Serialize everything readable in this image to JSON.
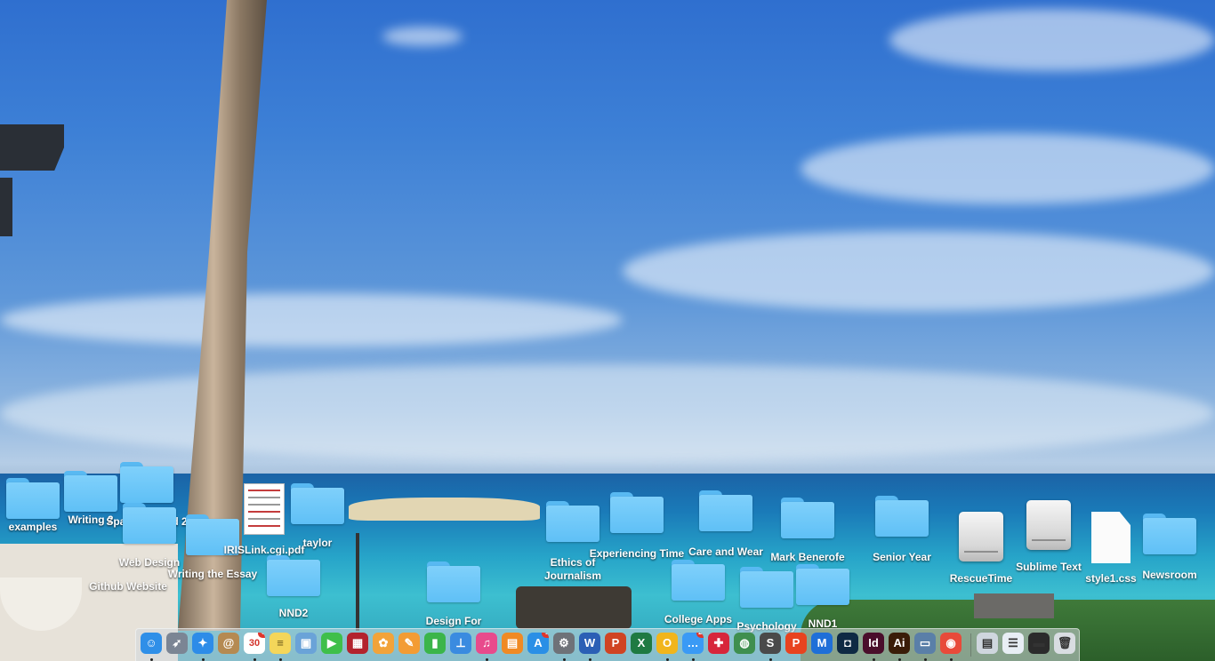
{
  "desktop_icons": [
    {
      "label": "examples",
      "kind": "folder"
    },
    {
      "label": "Writing 2",
      "kind": "folder"
    },
    {
      "label": "Spanish 1 and 2",
      "kind": "folder"
    },
    {
      "label": "Web Design",
      "kind": "folder"
    },
    {
      "label": "Github Website",
      "kind": "folder"
    },
    {
      "label": "Writing the Essay",
      "kind": "folder"
    },
    {
      "label": "IRISLink.cgi.pdf",
      "kind": "pdf"
    },
    {
      "label": "taylor",
      "kind": "folder"
    },
    {
      "label": "NND2",
      "kind": "folder"
    },
    {
      "label": "Design For",
      "kind": "folder"
    },
    {
      "label": "Ethics of Journalism",
      "kind": "folder"
    },
    {
      "label": "Experiencing Time",
      "kind": "folder"
    },
    {
      "label": "Care and Wear",
      "kind": "folder"
    },
    {
      "label": "College Apps",
      "kind": "folder"
    },
    {
      "label": "Psychology",
      "kind": "folder"
    },
    {
      "label": "Mark Benerofe",
      "kind": "folder"
    },
    {
      "label": "NND1",
      "kind": "folder"
    },
    {
      "label": "Senior Year",
      "kind": "folder"
    },
    {
      "label": "RescueTime",
      "kind": "drive"
    },
    {
      "label": "Sublime Text",
      "kind": "drive"
    },
    {
      "label": "style1.css",
      "kind": "document"
    },
    {
      "label": "Newsroom",
      "kind": "folder"
    }
  ],
  "dock": {
    "apps": [
      {
        "name": "Finder",
        "icon": "finder-icon",
        "glyph": "☺",
        "color": "#2f8fe8",
        "running": true
      },
      {
        "name": "Launchpad",
        "icon": "rocket-icon",
        "glyph": "➶",
        "color": "#7b8594",
        "running": false
      },
      {
        "name": "Safari",
        "icon": "compass-icon",
        "glyph": "✦",
        "color": "#2d8ce8",
        "running": true
      },
      {
        "name": "Contacts",
        "icon": "address-book-icon",
        "glyph": "@",
        "color": "#b58a52",
        "running": false
      },
      {
        "name": "Calendar",
        "icon": "calendar-icon",
        "glyph": "30",
        "color": "#ffffff",
        "badge": "6",
        "running": true
      },
      {
        "name": "Notes",
        "icon": "notes-icon",
        "glyph": "≡",
        "color": "#f4d65a",
        "running": true
      },
      {
        "name": "Preview",
        "icon": "preview-icon",
        "glyph": "▣",
        "color": "#6aa3d8",
        "running": false
      },
      {
        "name": "FaceTime",
        "icon": "video-camera-icon",
        "glyph": "▶",
        "color": "#3fbf4a",
        "running": false
      },
      {
        "name": "Photo Booth",
        "icon": "photo-booth-icon",
        "glyph": "▦",
        "color": "#b3232e",
        "running": false
      },
      {
        "name": "Photos",
        "icon": "photos-icon",
        "glyph": "✿",
        "color": "#f2a33a",
        "running": false
      },
      {
        "name": "Pages",
        "icon": "pages-icon",
        "glyph": "✎",
        "color": "#f39c34",
        "running": false
      },
      {
        "name": "Numbers",
        "icon": "numbers-icon",
        "glyph": "▮",
        "color": "#3bb54a",
        "running": false
      },
      {
        "name": "Keynote",
        "icon": "keynote-icon",
        "glyph": "⊥",
        "color": "#3a8be0",
        "running": false
      },
      {
        "name": "iTunes",
        "icon": "music-icon",
        "glyph": "♫",
        "color": "#e84a8c",
        "running": true
      },
      {
        "name": "iBooks",
        "icon": "book-icon",
        "glyph": "▤",
        "color": "#f08a24",
        "running": false
      },
      {
        "name": "App Store",
        "icon": "app-store-icon",
        "glyph": "A",
        "color": "#2a8fe6",
        "badge": "1",
        "running": false
      },
      {
        "name": "System Preferences",
        "icon": "gear-icon",
        "glyph": "⚙",
        "color": "#6e7278",
        "running": true
      },
      {
        "name": "Word",
        "icon": "word-icon",
        "glyph": "W",
        "color": "#2b5fb5",
        "running": true
      },
      {
        "name": "PowerPoint",
        "icon": "powerpoint-icon",
        "glyph": "P",
        "color": "#d04423",
        "running": false
      },
      {
        "name": "Excel",
        "icon": "excel-icon",
        "glyph": "X",
        "color": "#1f7a42",
        "running": false
      },
      {
        "name": "Outlook",
        "icon": "outlook-icon",
        "glyph": "O",
        "color": "#f1b51c",
        "running": true
      },
      {
        "name": "Messages",
        "icon": "chat-bubble-icon",
        "glyph": "…",
        "color": "#3a9af5",
        "badge": "25",
        "running": true
      },
      {
        "name": "Self Service",
        "icon": "plus-icon",
        "glyph": "✚",
        "color": "#d7263b",
        "running": false
      },
      {
        "name": "Network Utility",
        "icon": "globe-icon",
        "glyph": "◍",
        "color": "#3f8f4f",
        "running": false
      },
      {
        "name": "Sublime Text",
        "icon": "sublime-text-icon",
        "glyph": "S",
        "color": "#4a4a4a",
        "running": true
      },
      {
        "name": "Acrobat",
        "icon": "acrobat-icon",
        "glyph": "P",
        "color": "#e8431f",
        "running": false
      },
      {
        "name": "Malwarebytes",
        "icon": "malwarebytes-icon",
        "glyph": "M",
        "color": "#1f6fd8",
        "running": false
      },
      {
        "name": "Aspect",
        "icon": "square-frame-icon",
        "glyph": "◘",
        "color": "#0f2a44",
        "running": false
      },
      {
        "name": "InDesign",
        "icon": "indesign-icon",
        "glyph": "Id",
        "color": "#4a0e2b",
        "running": true
      },
      {
        "name": "Illustrator",
        "icon": "illustrator-icon",
        "glyph": "Ai",
        "color": "#3a1c08",
        "running": true
      },
      {
        "name": "Image Capture",
        "icon": "image-capture-icon",
        "glyph": "▭",
        "color": "#5a7fa8",
        "running": true
      },
      {
        "name": "Chrome",
        "icon": "chrome-icon",
        "glyph": "◉",
        "color": "#e84a3a",
        "running": true
      }
    ],
    "stacks": [
      {
        "name": "Downloads",
        "icon": "download-stack-icon",
        "glyph": "▤",
        "color": "#cfd6de"
      },
      {
        "name": "Documents",
        "icon": "documents-stack-icon",
        "glyph": "☰",
        "color": "#e8eef5"
      },
      {
        "name": "Screenshot",
        "icon": "screenshot-stack-icon",
        "glyph": "▬",
        "color": "#2b2b2b"
      },
      {
        "name": "Trash",
        "icon": "trash-icon",
        "glyph": "🗑",
        "color": "#d9dde2"
      }
    ]
  }
}
